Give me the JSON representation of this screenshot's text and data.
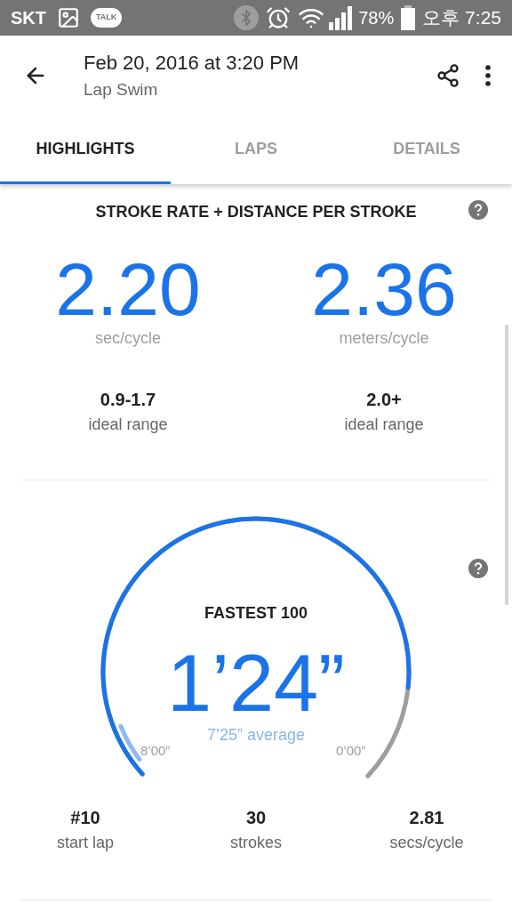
{
  "status_bar": {
    "carrier": "SKT",
    "chat_badge": "TALK",
    "battery": "78%",
    "time": "오후 7:25"
  },
  "header": {
    "title": "Feb 20, 2016 at 3:20 PM",
    "subtitle": "Lap Swim"
  },
  "tabs": [
    {
      "label": "HIGHLIGHTS",
      "selected": true
    },
    {
      "label": "LAPS",
      "selected": false
    },
    {
      "label": "DETAILS",
      "selected": false
    }
  ],
  "stroke_section": {
    "title": "STROKE RATE + DISTANCE PER STROKE",
    "metrics": [
      {
        "value": "2.20",
        "unit": "sec/cycle",
        "range": "0.9-1.7",
        "range_label": "ideal range"
      },
      {
        "value": "2.36",
        "unit": "meters/cycle",
        "range": "2.0+",
        "range_label": "ideal range"
      }
    ]
  },
  "fastest_section": {
    "title": "FASTEST 100",
    "time": "1’24”",
    "average": "7’25” average",
    "gauge": {
      "min_label": "8’00”",
      "max_label": "0’00”"
    },
    "stats": [
      {
        "value": "#10",
        "label": "start lap"
      },
      {
        "value": "30",
        "label": "strokes"
      },
      {
        "value": "2.81",
        "label": "secs/cycle"
      }
    ]
  }
}
